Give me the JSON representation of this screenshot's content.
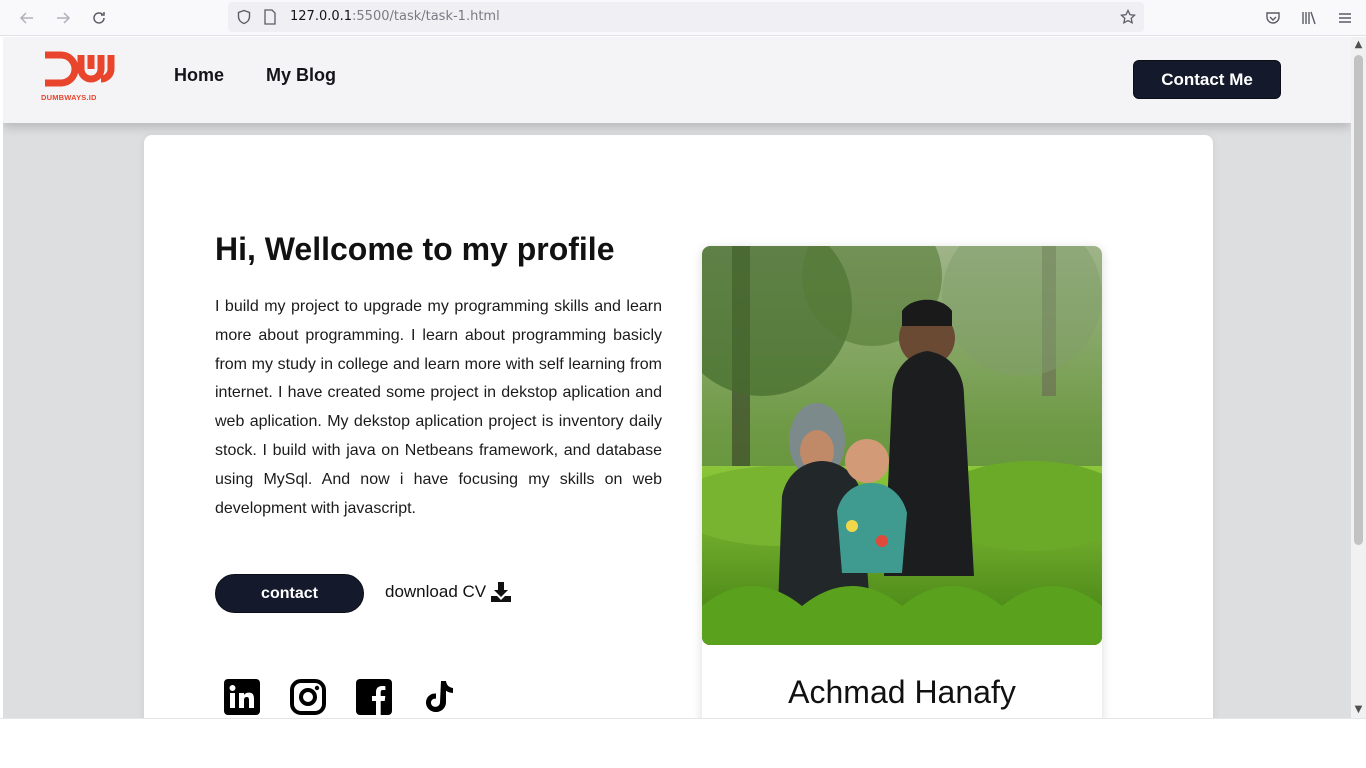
{
  "browser": {
    "url_host": "127.0.0.1",
    "url_path": ":5500/task/task-1.html"
  },
  "site": {
    "logo_text": "DUMBWAYS.ID",
    "nav": {
      "home": "Home",
      "blog": "My Blog",
      "contact": "Contact Me"
    }
  },
  "hero": {
    "title": "Hi, Wellcome to my profile",
    "body": "I build my project to upgrade my programming skills and learn more about programming. I learn about programming basicly from my study in college and learn more with self learning from internet. I have created some project in dekstop aplication and web aplication. My dekstop aplication project is inventory daily stock. I build with java on Netbeans framework, and database using MySql. And now i have focusing my skills on web development with javascript.",
    "contact_button": "contact",
    "download_label": "download CV"
  },
  "socials": [
    "linkedin-icon",
    "instagram-icon",
    "facebook-icon",
    "tiktok-icon"
  ],
  "profile": {
    "name": "Achmad Hanafy"
  },
  "colors": {
    "brand": "#e8452c",
    "dark_button": "#141a2b",
    "page_bg": "#dddee0"
  }
}
